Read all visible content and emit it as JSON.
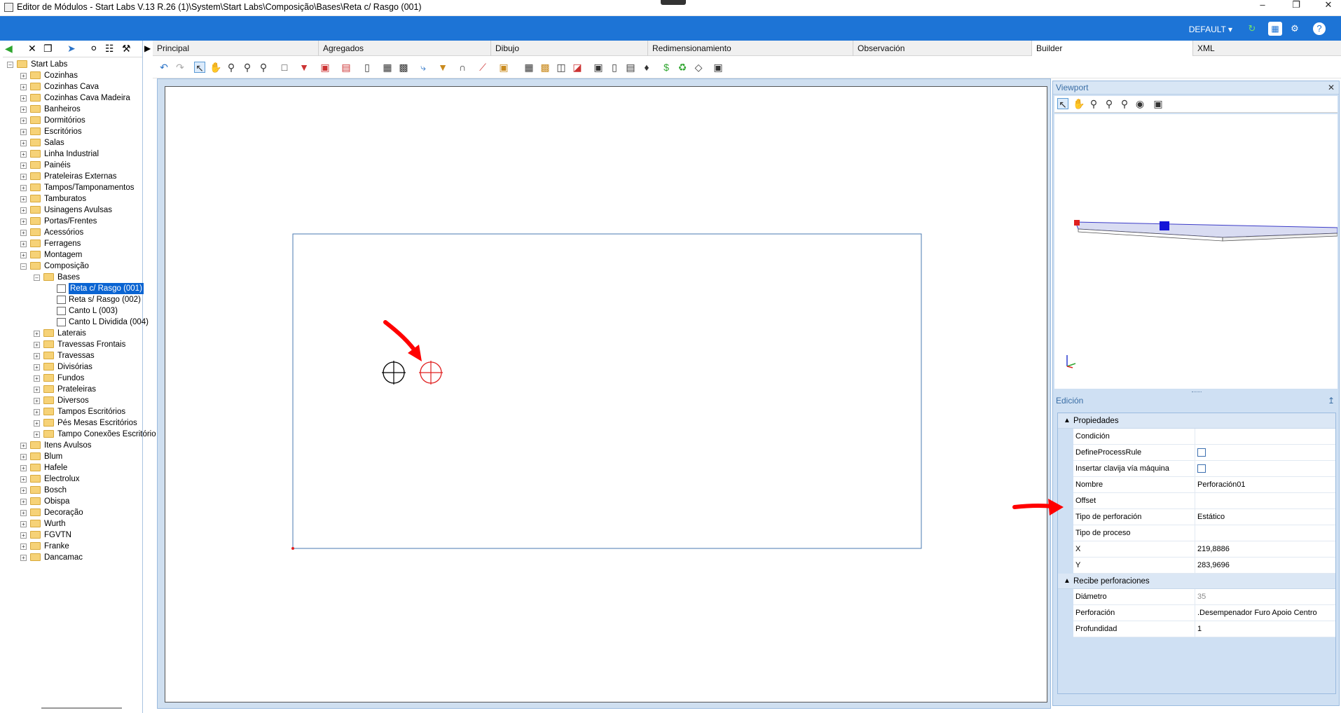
{
  "window": {
    "title": "Editor de Módulos - Start Labs V.13 R.26 (1)\\System\\Start Labs\\Composição\\Bases\\Reta c/ Rasgo (001)"
  },
  "topbar": {
    "profile_label": "DEFAULT",
    "accent_color": "#1d74d6"
  },
  "tree": {
    "root": "Start Labs",
    "items": [
      "Cozinhas",
      "Cozinhas Cava",
      "Cozinhas Cava Madeira",
      "Banheiros",
      "Dormitórios",
      "Escritórios",
      "Salas",
      "Linha Industrial",
      "Painéis",
      "Prateleiras Externas",
      "Tampos/Tamponamentos",
      "Tamburatos",
      "Usinagens Avulsas",
      "Portas/Frentes",
      "Acessórios",
      "Ferragens",
      "Montagem",
      "Composição"
    ],
    "composicao_children": {
      "bases": "Bases",
      "bases_items": [
        "Reta c/ Rasgo (001)",
        "Reta s/ Rasgo (002)",
        "Canto L (003)",
        "Canto L Dividida (004)"
      ],
      "others": [
        "Laterais",
        "Travessas Frontais",
        "Travessas",
        "Divisórias",
        "Fundos",
        "Prateleiras",
        "Diversos",
        "Tampos Escritórios",
        "Pés Mesas Escritórios",
        "Tampo Conexões Escritório"
      ]
    },
    "after_items": [
      "Itens Avulsos",
      "Blum",
      "Hafele",
      "Electrolux",
      "Bosch",
      "Obispa",
      "Decoração",
      "Wurth",
      "FGVTN",
      "Franke",
      "Dancamac"
    ],
    "selected": "Reta c/ Rasgo (001)"
  },
  "tabs": [
    "Principal",
    "Agregados",
    "Dibujo",
    "Redimensionamiento",
    "Observación",
    "Builder",
    "XML"
  ],
  "active_tab": "Builder",
  "viewport": {
    "title": "Viewport"
  },
  "edicion": {
    "title": "Edición",
    "categories": {
      "propiedades": "Propiedades",
      "recibe": "Recibe perforaciones"
    },
    "properties": [
      {
        "name": "Condición",
        "value": ""
      },
      {
        "name": "DefineProcessRule",
        "value": ""
      },
      {
        "name": "Insertar clavija vía máquina",
        "value": ""
      },
      {
        "name": "Nombre",
        "value": "Perforación01"
      },
      {
        "name": "Offset",
        "value": ""
      },
      {
        "name": "Tipo de perforación",
        "value": "Estático"
      },
      {
        "name": "Tipo de proceso",
        "value": ""
      },
      {
        "name": "X",
        "value": "219,8886"
      },
      {
        "name": "Y",
        "value": "283,9696"
      }
    ],
    "recibe_properties": [
      {
        "name": "Diámetro",
        "value": "35"
      },
      {
        "name": "Perforación",
        "value": ".Desempenador Furo Apoio Centro"
      },
      {
        "name": "Profundidad",
        "value": "1"
      }
    ]
  }
}
